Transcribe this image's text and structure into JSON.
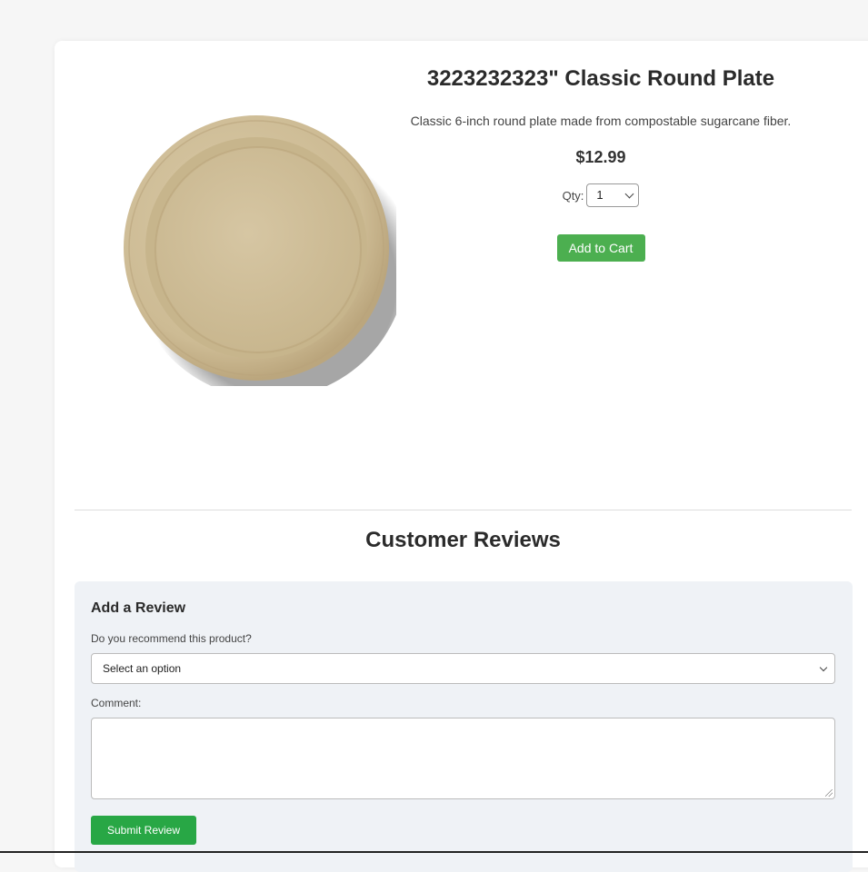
{
  "product": {
    "title": "3223232323\" Classic Round Plate",
    "description": "Classic 6-inch round plate made from compostable sugarcane fiber.",
    "price": "$12.99",
    "qty_label": "Qty:",
    "qty_value": "1",
    "add_to_cart_label": "Add to Cart",
    "image_icon": "round-plate-image"
  },
  "reviews": {
    "heading": "Customer Reviews",
    "form_title": "Add a Review",
    "recommend_label": "Do you recommend this product?",
    "recommend_value": "Select an option",
    "comment_label": "Comment:",
    "comment_value": "",
    "submit_label": "Submit Review"
  },
  "colors": {
    "add_to_cart": "#4caf50",
    "submit": "#28a745",
    "review_bg": "#eff2f6"
  }
}
